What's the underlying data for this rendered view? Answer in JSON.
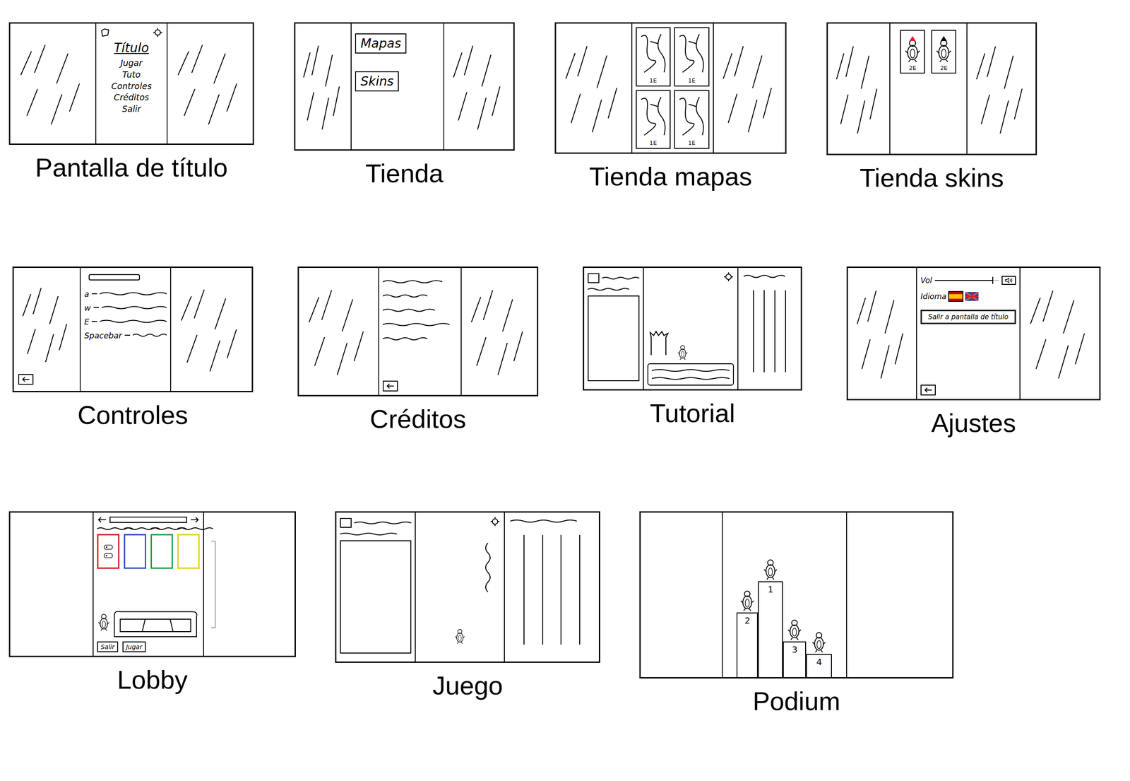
{
  "screens": [
    {
      "kind": "title",
      "caption": "Pantalla de título",
      "heading": "Título",
      "menu": [
        "Jugar",
        "Tuto",
        "Controles",
        "Créditos",
        "Salir"
      ]
    },
    {
      "kind": "shop",
      "caption": "Tienda",
      "buttons": [
        "Mapas",
        "Skins"
      ]
    },
    {
      "kind": "maps",
      "caption": "Tienda mapas",
      "items": [
        {
          "price": "1E"
        },
        {
          "price": "1E"
        },
        {
          "price": "1E"
        },
        {
          "price": "1E"
        }
      ]
    },
    {
      "kind": "skins",
      "caption": "Tienda skins",
      "items": [
        {
          "price": "2E",
          "color": "#e02020"
        },
        {
          "price": "2E",
          "color": "#000000"
        }
      ]
    },
    {
      "kind": "controls",
      "caption": "Controles",
      "keys": [
        "a",
        "w",
        "E",
        "Spacebar"
      ]
    },
    {
      "kind": "credits",
      "caption": "Créditos"
    },
    {
      "kind": "tutorial",
      "caption": "Tutorial"
    },
    {
      "kind": "settings",
      "caption": "Ajustes",
      "volume_label": "Vol",
      "volume_level": 0.9,
      "language_label": "Idioma",
      "languages": [
        {
          "selected": true
        },
        {
          "selected": false
        }
      ],
      "exit": "Salir a pantalla de título"
    },
    {
      "kind": "lobby",
      "caption": "Lobby",
      "teams": [
        {
          "color": "#d02020",
          "players": 2
        },
        {
          "color": "#3050c0",
          "players": 0
        },
        {
          "color": "#20a040",
          "players": 0
        },
        {
          "color": "#e0d020",
          "players": 0
        }
      ],
      "buttons": [
        "Salir",
        "Jugar"
      ]
    },
    {
      "kind": "game",
      "caption": "Juego"
    },
    {
      "kind": "podium",
      "caption": "Podium",
      "places": [
        "2",
        "1",
        "3",
        "4"
      ]
    }
  ]
}
